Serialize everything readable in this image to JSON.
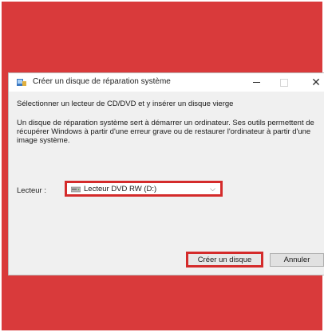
{
  "window": {
    "title": "Créer un disque de réparation système",
    "close_glyph": "✕"
  },
  "content": {
    "heading": "Sélectionner un lecteur de CD/DVD et y insérer un disque vierge",
    "description": "Un disque de réparation système sert à démarrer un ordinateur. Ses outils permettent de récupérer Windows à partir d'une erreur grave ou de restaurer l'ordinateur à partir d'une image système."
  },
  "drive": {
    "label": "Lecteur :",
    "selected": "Lecteur DVD RW (D:)",
    "chevron": "⌵"
  },
  "buttons": {
    "create_label": "Créer un disque",
    "cancel_label": "Annuler"
  },
  "colors": {
    "background_red": "#d93a3b",
    "highlight_red": "#d42b2b",
    "dialog_bg": "#f0f0f0"
  }
}
